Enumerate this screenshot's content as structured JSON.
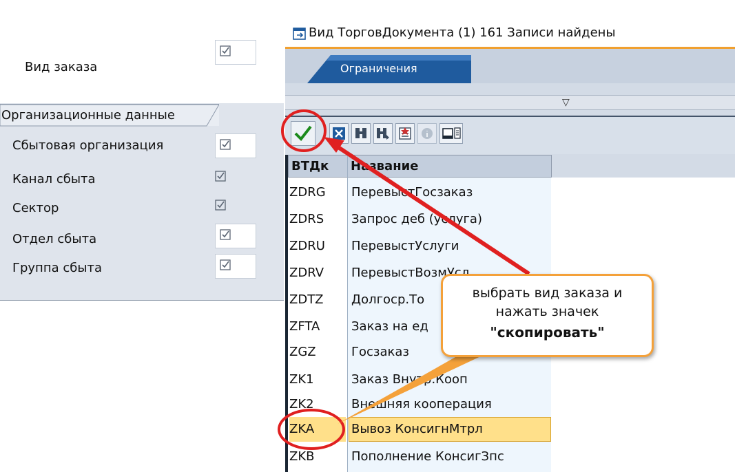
{
  "left_panel": {
    "order_type": {
      "label": "Вид заказа",
      "checked": true
    },
    "org_tab_label": "Организационные данные",
    "rows": [
      {
        "label": "Сбытовая организация",
        "checked": true
      },
      {
        "label": "Канал сбыта",
        "checked": true
      },
      {
        "label": "Сектор",
        "checked": true
      },
      {
        "label": "Отдел сбыта",
        "checked": true
      },
      {
        "label": "Группа сбыта",
        "checked": true
      }
    ]
  },
  "dialog": {
    "title": "Вид ТорговДокумента (1)  161 Записи найдены",
    "tab_label": "Ограничения",
    "toolbar_icons": [
      "copy-checkmark-icon",
      "cancel-icon",
      "find-icon",
      "find-next-icon",
      "multi-select-icon",
      "info-icon",
      "print-icon"
    ],
    "columns": {
      "code": "ВТДк",
      "name": "Название"
    },
    "rows": [
      {
        "code": "ZDRG",
        "name": "ПеревыстГосзаказ"
      },
      {
        "code": "ZDRS",
        "name": "Запрос деб (услуга)"
      },
      {
        "code": "ZDRU",
        "name": "ПеревыстУслуги"
      },
      {
        "code": "ZDRV",
        "name": "ПеревыстВозмУсл"
      },
      {
        "code": "ZDTZ",
        "name": "Долгоср.То"
      },
      {
        "code": "ZFTA",
        "name": "Заказ на ед"
      },
      {
        "code": "ZGZ",
        "name": "Госзаказ"
      },
      {
        "code": "ZK1",
        "name": "Заказ Внутр.Кооп"
      },
      {
        "code": "ZK2",
        "name": "Внешняя кооперация"
      },
      {
        "code": "ZKA",
        "name": "Вывоз КонсигнМтрл"
      },
      {
        "code": "ZKB",
        "name": "Пополнение КонсигЗпс"
      }
    ],
    "selected_row": "ZKA"
  },
  "callout": {
    "line1": "выбрать вид заказа и",
    "line2": "нажать значек",
    "line3": "\"скопировать\""
  },
  "colors": {
    "accent_orange": "#f4a13a",
    "highlight_red": "#e02020",
    "selected_row": "#ffe08a",
    "sap_blue_tab": "#1f5b9e"
  }
}
